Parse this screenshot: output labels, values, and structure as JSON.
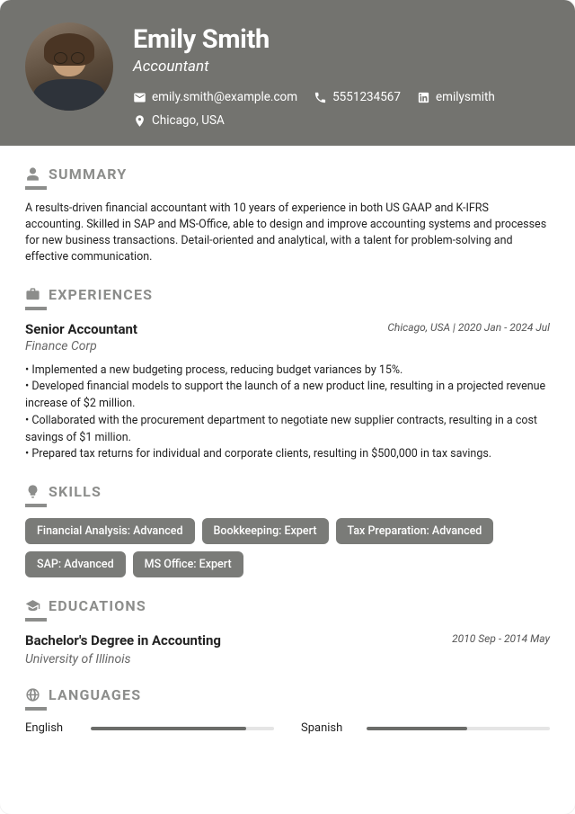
{
  "header": {
    "name": "Emily Smith",
    "title": "Accountant",
    "email": "emily.smith@example.com",
    "phone": "5551234567",
    "linkedin": "emilysmith",
    "location": "Chicago, USA"
  },
  "sections": {
    "summary": {
      "heading": "SUMMARY",
      "text": "A results-driven financial accountant with 10 years of experience in both US GAAP and K-IFRS accounting. Skilled in SAP and MS-Office, able to design and improve accounting systems and processes for new business transactions. Detail-oriented and analytical, with a talent for problem-solving and effective communication."
    },
    "experiences": {
      "heading": "EXPERIENCES",
      "items": [
        {
          "title": "Senior Accountant",
          "company": "Finance Corp",
          "location": "Chicago, USA",
          "dates": "2020 Jan - 2024 Jul",
          "bullets": [
            "Implemented a new budgeting process, reducing budget variances by 15%.",
            "Developed financial models to support the launch of a new product line, resulting in a projected revenue increase of $2 million.",
            "Collaborated with the procurement department to negotiate new supplier contracts, resulting in a cost savings of $1 million.",
            "Prepared tax returns for individual and corporate clients, resulting in $500,000 in tax savings."
          ]
        }
      ]
    },
    "skills": {
      "heading": "SKILLS",
      "items": [
        "Financial Analysis: Advanced",
        "Bookkeeping: Expert",
        "Tax Preparation: Advanced",
        "SAP: Advanced",
        "MS Office: Expert"
      ]
    },
    "educations": {
      "heading": "EDUCATIONS",
      "items": [
        {
          "degree": "Bachelor's Degree in Accounting",
          "school": "University of Illinois",
          "dates": "2010 Sep - 2014 May"
        }
      ]
    },
    "languages": {
      "heading": "LANGUAGES",
      "items": [
        {
          "name": "English",
          "level": 85
        },
        {
          "name": "Spanish",
          "level": 55
        }
      ]
    }
  }
}
